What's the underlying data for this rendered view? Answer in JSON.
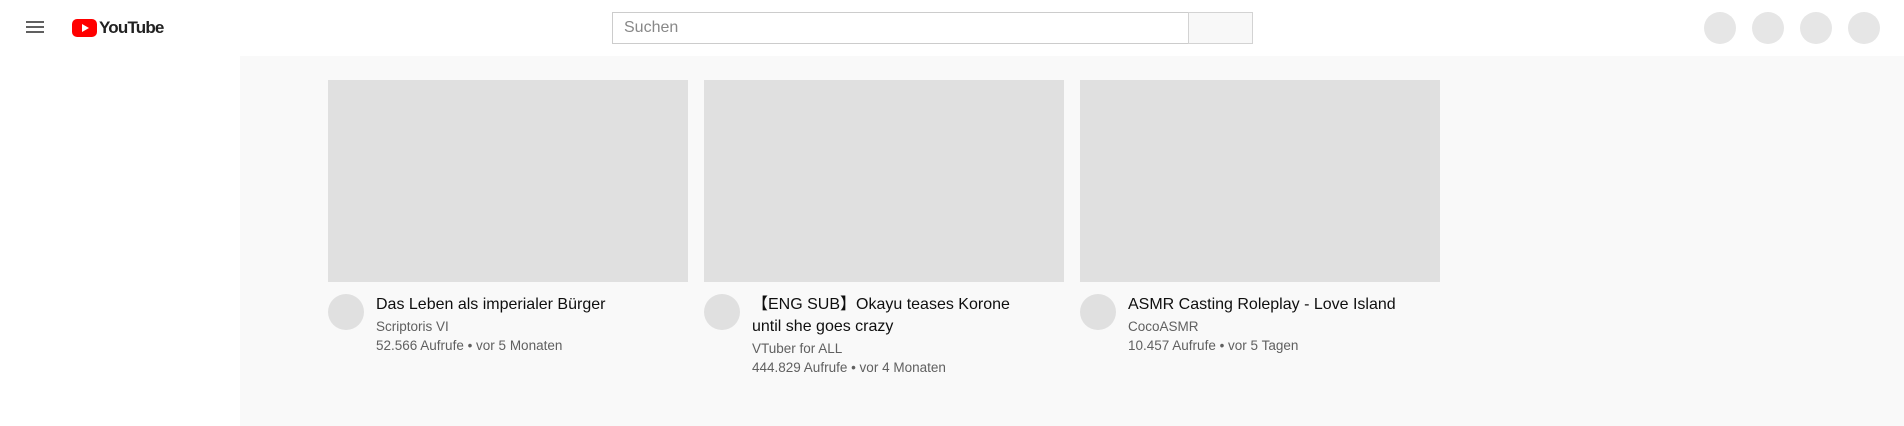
{
  "header": {
    "logo_text": "YouTube",
    "search_placeholder": "Suchen"
  },
  "videos": [
    {
      "title": "Das Leben als imperialer Bürger",
      "channel": "Scriptoris VI",
      "stats": "52.566 Aufrufe • vor 5 Monaten"
    },
    {
      "title": "【ENG SUB】Okayu teases Korone until she goes crazy",
      "channel": "VTuber for ALL",
      "stats": "444.829 Aufrufe • vor 4 Monaten"
    },
    {
      "title": "ASMR Casting Roleplay - Love Island",
      "channel": "CocoASMR",
      "stats": "10.457 Aufrufe • vor 5 Tagen"
    }
  ],
  "colors": {
    "brand": "#ff0000",
    "page_background": "#f9f9f9",
    "placeholder_gray": "#e0e0e0",
    "secondary_text": "#606060"
  }
}
